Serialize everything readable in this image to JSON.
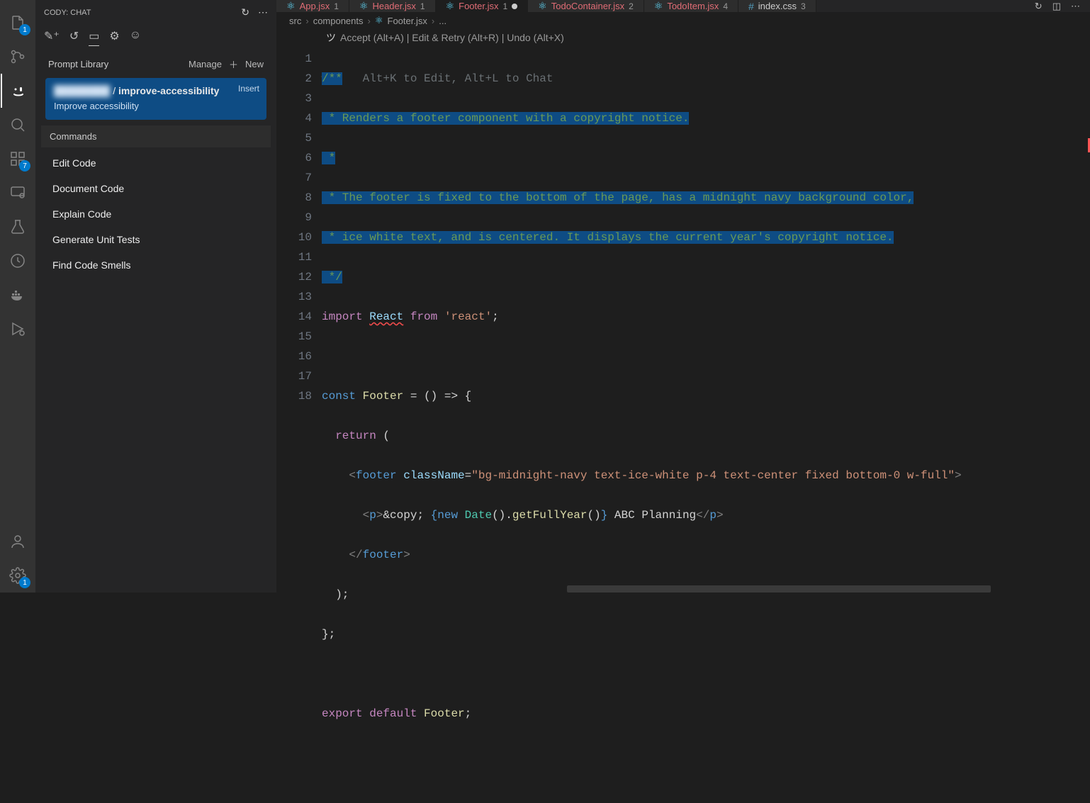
{
  "activity_badges": {
    "explorer": "1",
    "extensions": "7",
    "settings": "1"
  },
  "sidebar": {
    "title": "CODY: CHAT",
    "library": {
      "heading": "Prompt Library",
      "manage": "Manage",
      "new": "New",
      "card_title_sep": " / ",
      "card_title_bold": "improve-accessibility",
      "card_desc": "Improve accessibility",
      "insert": "Insert"
    },
    "commands_heading": "Commands",
    "commands": [
      "Edit Code",
      "Document Code",
      "Explain Code",
      "Generate Unit Tests",
      "Find Code Smells"
    ]
  },
  "tabs": [
    {
      "icon": "react",
      "name": "App.jsx",
      "num": "1"
    },
    {
      "icon": "react",
      "name": "Header.jsx",
      "num": "1"
    },
    {
      "icon": "react",
      "name": "Footer.jsx",
      "num": "1",
      "active": true,
      "dirty": true
    },
    {
      "icon": "react",
      "name": "TodoContainer.jsx",
      "num": "2"
    },
    {
      "icon": "react",
      "name": "TodoItem.jsx",
      "num": "4"
    },
    {
      "icon": "hash",
      "name": "index.css",
      "num": "3",
      "css": true
    }
  ],
  "breadcrumb": [
    "src",
    "components",
    "Footer.jsx",
    "..."
  ],
  "code_actions": "Accept (Alt+A) | Edit & Retry (Alt+R) | Undo (Alt+X)",
  "hint": "Alt+K to Edit, Alt+L to Chat",
  "code": {
    "l1a": "/**",
    "l2": " * Renders a footer component with a copyright notice.",
    "l3": " *",
    "l4": " * The footer is fixed to the bottom of the page, has a midnight navy background color,",
    "l5": " * ice white text, and is centered. It displays the current year's copyright notice.",
    "l6": " */",
    "l7_import": "import",
    "l7_react": "React",
    "l7_from": "from",
    "l7_str": "'react'",
    "l9_const": "const",
    "l9_name": "Footer",
    "l9_eq": " = () => {",
    "l10_return": "return",
    "l10_paren": " (",
    "l11_open": "<",
    "l11_tag": "footer",
    "l11_attr": "className",
    "l11_val": "\"bg-midnight-navy text-ice-white p-4 text-center fixed bottom-0 w-full\"",
    "l11_close": ">",
    "l12_p_open": "<p>",
    "l12_entity": "&copy;",
    "l12_brace_open": " {",
    "l12_new": "new",
    "l12_date": "Date",
    "l12_call1": "().",
    "l12_getfull": "getFullYear",
    "l12_call2": "()",
    "l12_brace_close": "}",
    "l12_text": " ABC Planning",
    "l12_p_close": "</p>",
    "l13": "</footer>",
    "l14": ");",
    "l15": "};",
    "l17_export": "export",
    "l17_default": "default",
    "l17_name": "Footer",
    "semi": ";"
  },
  "line_count": 18
}
